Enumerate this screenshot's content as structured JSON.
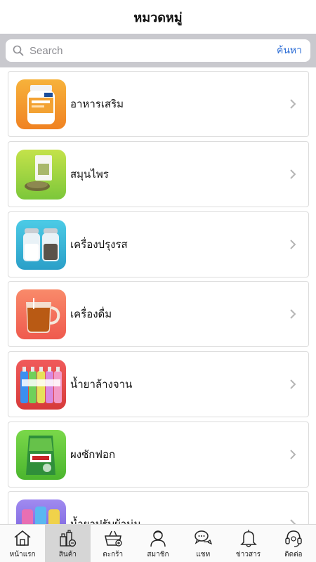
{
  "header": {
    "title": "หมวดหมู่"
  },
  "search": {
    "placeholder": "Search",
    "button_label": "ค้นหา"
  },
  "categories": [
    {
      "label": "อาหารเสริม",
      "icon": "supplement-bottle-icon",
      "color": "#f39a2a"
    },
    {
      "label": "สมุนไพร",
      "icon": "herb-bag-icon",
      "color": "#9cd43a"
    },
    {
      "label": "เครื่องปรุงรส",
      "icon": "salt-pepper-icon",
      "color": "#38b8d8"
    },
    {
      "label": "เครื่องดื่ม",
      "icon": "tea-cup-icon",
      "color": "#f4725c"
    },
    {
      "label": "น้ำยาล้างจาน",
      "icon": "detergent-bottles-icon",
      "color": "#e54545"
    },
    {
      "label": "ผงซักฟอก",
      "icon": "washing-powder-icon",
      "color": "#5fc93a"
    },
    {
      "label": "น้ำยาปรับผ้านุ่ม",
      "icon": "softener-bottles-icon",
      "color": "#8a6fe0"
    }
  ],
  "tabs": [
    {
      "label": "หน้าแรก",
      "icon": "home-icon"
    },
    {
      "label": "สินค้า",
      "icon": "products-icon",
      "active": true
    },
    {
      "label": "ตะกร้า",
      "icon": "basket-icon"
    },
    {
      "label": "สมาชิก",
      "icon": "member-icon"
    },
    {
      "label": "แชท",
      "icon": "chat-icon"
    },
    {
      "label": "ข่าวสาร",
      "icon": "bell-icon"
    },
    {
      "label": "ติดต่อ",
      "icon": "headset-icon"
    }
  ]
}
